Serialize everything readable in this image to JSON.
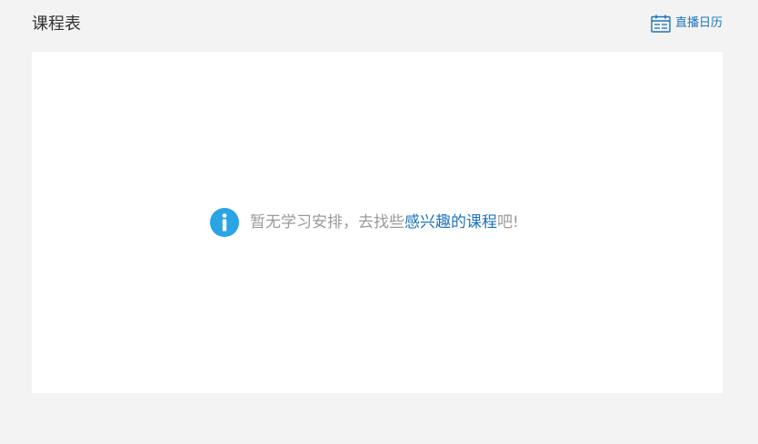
{
  "header": {
    "title": "课程表",
    "calendar_link": {
      "label": "直播日历",
      "icon": "calendar-icon"
    }
  },
  "empty_state": {
    "icon": "info-icon",
    "text_before": "暂无学习安排，去找些",
    "link_text": "感兴趣的课程",
    "text_after": "吧!"
  },
  "colors": {
    "page_background": "#f3f3f3",
    "panel_background": "#ffffff",
    "link": "#1d73b8",
    "info_icon": "#2aa4e3",
    "muted_text": "#9a9a9a",
    "title_text": "#333333"
  }
}
